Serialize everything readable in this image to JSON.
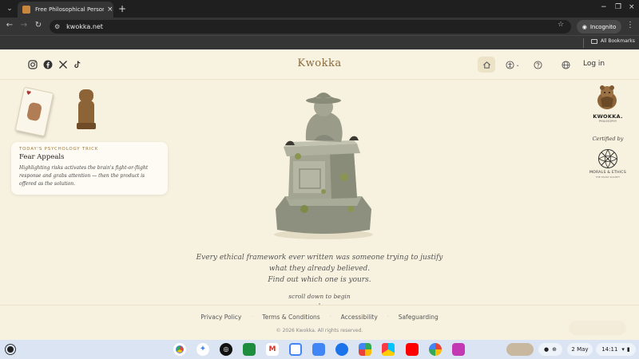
{
  "browser": {
    "tab_title": "Free Philosophical Personality",
    "tab_close": "×",
    "new_tab": "+",
    "win_min": "−",
    "win_max": "❐",
    "win_close": "×",
    "url": "kwokka.net",
    "incognito_label": "Incognito",
    "bookmarks_label": "All Bookmarks"
  },
  "site": {
    "brand": "Kwokka",
    "login_label": "Log in",
    "social": [
      "instagram-icon",
      "facebook-icon",
      "x-icon",
      "tiktok-icon"
    ]
  },
  "trick": {
    "kicker": "TODAY'S PSYCHOLOGY TRICK",
    "title": "Fear Appeals",
    "body": "Highlighting risks activates the brain's fight-or-flight response and grabs attention — then the product is offered as the solution."
  },
  "badges": {
    "kwokka_word": "KWOKKA.",
    "kwokka_sub": "PHILOSOPHY",
    "certified": "Certified by",
    "ethics_word": "MORALS & ETHICS",
    "ethics_sub": "THE TRUST SOCIETY"
  },
  "hero": {
    "tagline_1": "Every ethical framework ever written was someone trying to justify",
    "tagline_2": "what they already believed.",
    "tagline_3": "Find out which one is yours.",
    "scroll_hint": "scroll down to begin"
  },
  "footer": {
    "links": [
      "Privacy Policy",
      "Terms & Conditions",
      "Accessibility",
      "Safeguarding"
    ],
    "copyright": "© 2026 Kwokka. All rights reserved."
  },
  "shelf": {
    "date": "2 May",
    "time": "14:11"
  },
  "colors": {
    "page_bg": "#f7f1df",
    "brand": "#8a6a3a",
    "chrome_dark": "#1f1f1f"
  }
}
